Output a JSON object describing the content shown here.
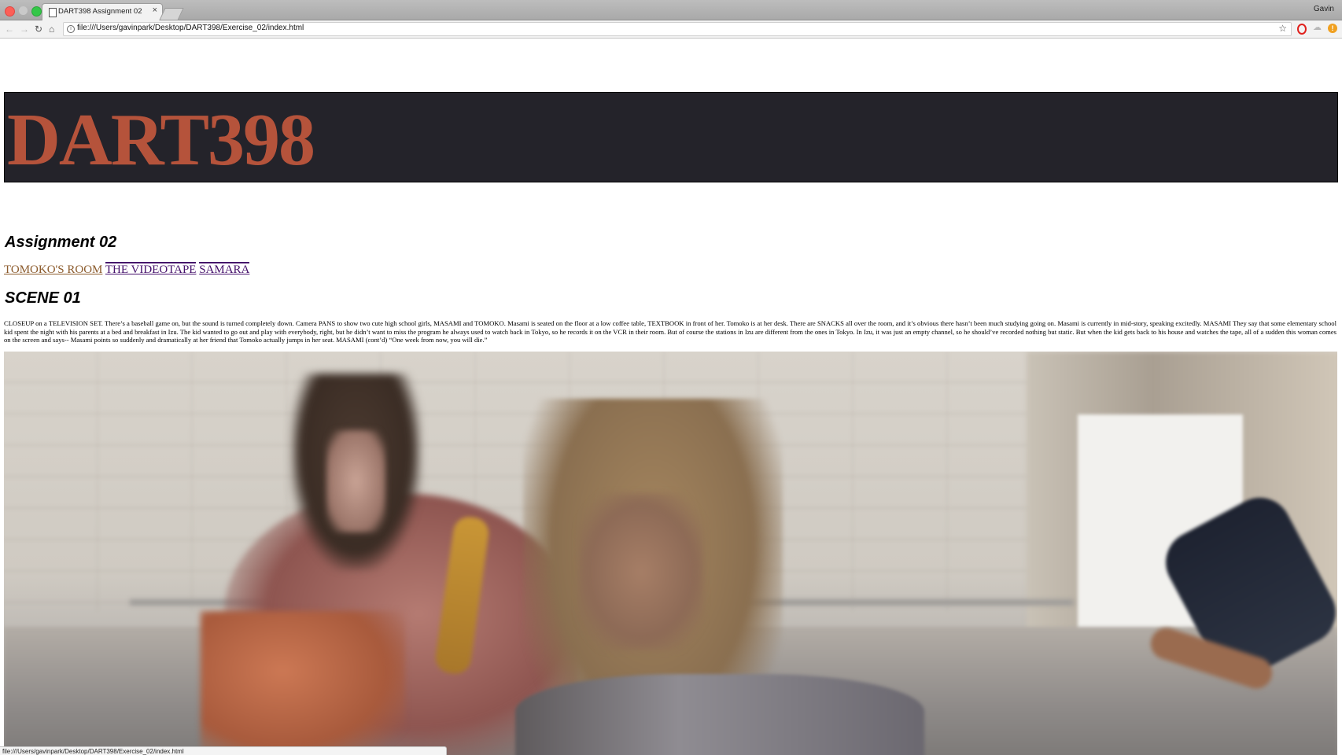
{
  "browser": {
    "tab_title": "DART398 Assignment 02",
    "tab_close": "×",
    "profile_name": "Gavin",
    "url": "file:///Users/gavinpark/Desktop/DART398/Exercise_02/index.html",
    "nav_icons": {
      "back": "←",
      "forward": "→",
      "reload": "↻",
      "home": "⌂",
      "bookmark": "☆"
    },
    "extensions": [
      "opera-icon",
      "cloud-icon",
      "warning-icon"
    ],
    "status_url": "file:///Users/gavinpark/Desktop/DART398/Exercise_02/index.html"
  },
  "page": {
    "site_title": "DART398",
    "heading": "Assignment 02",
    "nav_links": [
      "TOMOKO'S ROOM",
      "THE VIDEOTAPE",
      "SAMARA"
    ],
    "scene_heading": "SCENE 01",
    "scene_text": "CLOSEUP on a TELEVISION SET. There’s a baseball game on, but the sound is turned completely down. Camera PANS to show two cute high school girls, MASAMI and TOMOKO. Masami is seated on the floor at a low coffee table, TEXTBOOK in front of her. Tomoko is at her desk. There are SNACKS all over the room, and it’s obvious there hasn’t been much studying going on. Masami is currently in mid-story, speaking excitedly. MASAMI They say that some elementary school kid spent the night with his parents at a bed and breakfast in Izu. The kid wanted to go out and play with everybody, right, but he didn’t want to miss the program he always used to watch back in Tokyo, so he records it on the VCR in their room. But of course the stations in Izu are different from the ones in Tokyo. In Izu, it was just an empty channel, so he should’ve recorded nothing but static. But when the kid gets back to his house and watches the tape, all of a sudden this woman comes on the screen and says-- Masami points so suddenly and dramatically at her friend that Tomoko actually jumps in her seat. MASAMI (cont’d) “One week from now, you will die.”"
  },
  "colors": {
    "header_background": "#24232a",
    "title_color": "#b5533b",
    "visited_link": "#8b5a2b",
    "link": "#45106b"
  }
}
